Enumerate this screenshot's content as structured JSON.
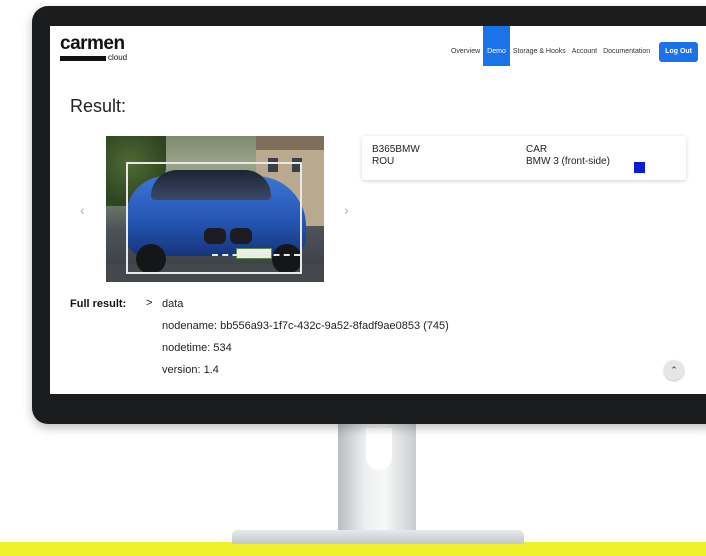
{
  "brand": {
    "name": "carmen",
    "sub": "cloud"
  },
  "nav": {
    "items": [
      "Overview",
      "Demo",
      "Storage & Hooks",
      "Account",
      "Documentation"
    ],
    "active_index": 1,
    "logout_label": "Log Out",
    "accent": "#1a73e8"
  },
  "result": {
    "title": "Result:",
    "plate_text": "B365BMW",
    "country": "ROU",
    "category": "CAR",
    "make_model": "BMW 3 (front-side)",
    "vehicle_color": "#0a1cd6",
    "prev_icon": "chevron-left-icon",
    "next_icon": "chevron-right-icon"
  },
  "full_result": {
    "label": "Full result:",
    "chevron": ">",
    "rows": [
      "data",
      "nodename: bb556a93-1f7c-432c-9a52-8fadf9ae0853 (745)",
      "nodetime: 534",
      "version: 1.4"
    ]
  },
  "scroll_top_icon": "chevron-up-icon"
}
